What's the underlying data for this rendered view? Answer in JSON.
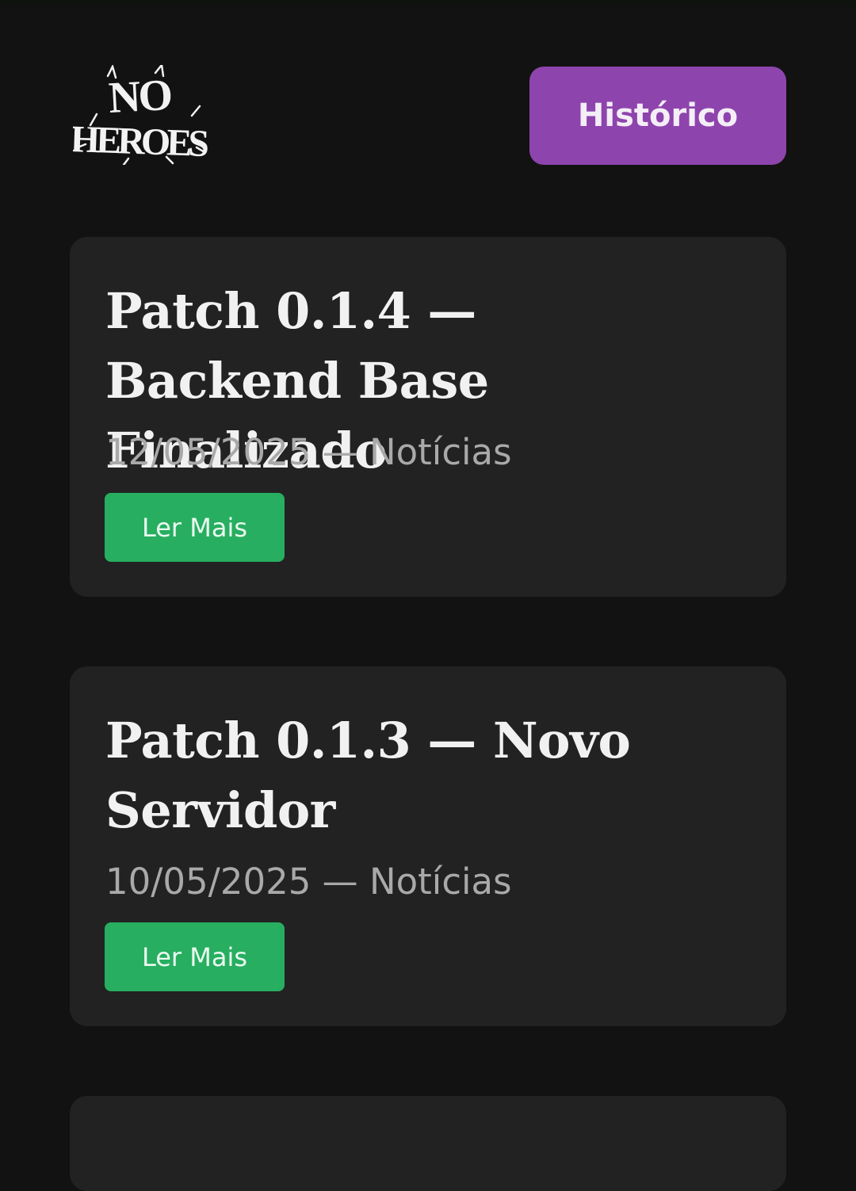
{
  "header": {
    "logo_text": "NO HEROES",
    "history_button_label": "Histórico"
  },
  "colors": {
    "background": "#121212",
    "card": "#222222",
    "accent_purple": "#8e44ad",
    "accent_green": "#27ae60"
  },
  "icons": {
    "logo": "no-heroes-logo"
  },
  "posts": [
    {
      "title": "Patch 0.1.4 — Backend Base Finalizado",
      "date": "12/05/2025",
      "separator": "—",
      "category": "Notícias",
      "meta": "12/05/2025 — Notícias",
      "button_label": "Ler Mais"
    },
    {
      "title": "Patch 0.1.3 — Novo Servidor",
      "date": "10/05/2025",
      "separator": "—",
      "category": "Notícias",
      "meta": "10/05/2025 — Notícias",
      "button_label": "Ler Mais"
    }
  ]
}
